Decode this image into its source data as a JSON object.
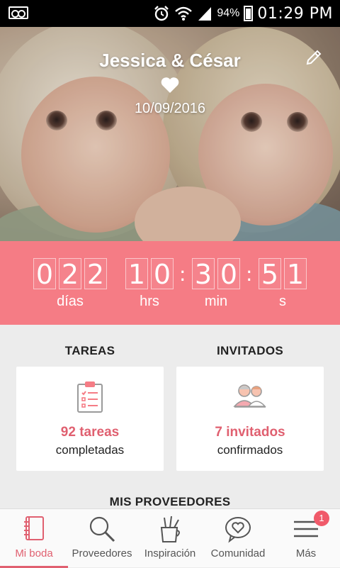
{
  "status_bar": {
    "battery": "94%",
    "time": "01:29 PM"
  },
  "header": {
    "couple": "Jessica & César",
    "date": "10/09/2016"
  },
  "countdown": {
    "days_digits": [
      "0",
      "2",
      "2"
    ],
    "hours_digits": [
      "1",
      "0"
    ],
    "minutes_digits": [
      "3",
      "0"
    ],
    "seconds_digits": [
      "5",
      "1"
    ],
    "separator": ":",
    "labels": {
      "days": "días",
      "hours": "hrs",
      "minutes": "min",
      "seconds": "s"
    }
  },
  "tasks": {
    "heading": "TAREAS",
    "count": "92 tareas",
    "subtitle": "completadas"
  },
  "guests": {
    "heading": "INVITADOS",
    "count": "7 invitados",
    "subtitle": "confirmados"
  },
  "providers": {
    "heading": "MIS PROVEEDORES"
  },
  "nav": {
    "items": [
      {
        "label": "Mi boda",
        "icon": "notebook-icon"
      },
      {
        "label": "Proveedores",
        "icon": "search-icon"
      },
      {
        "label": "Inspiración",
        "icon": "pencil-cup-icon"
      },
      {
        "label": "Comunidad",
        "icon": "heart-bubble-icon"
      },
      {
        "label": "Más",
        "icon": "menu-icon"
      }
    ],
    "badge": "1"
  },
  "colors": {
    "accent": "#f57c85",
    "accent_text": "#e06070",
    "background": "#ececec"
  }
}
